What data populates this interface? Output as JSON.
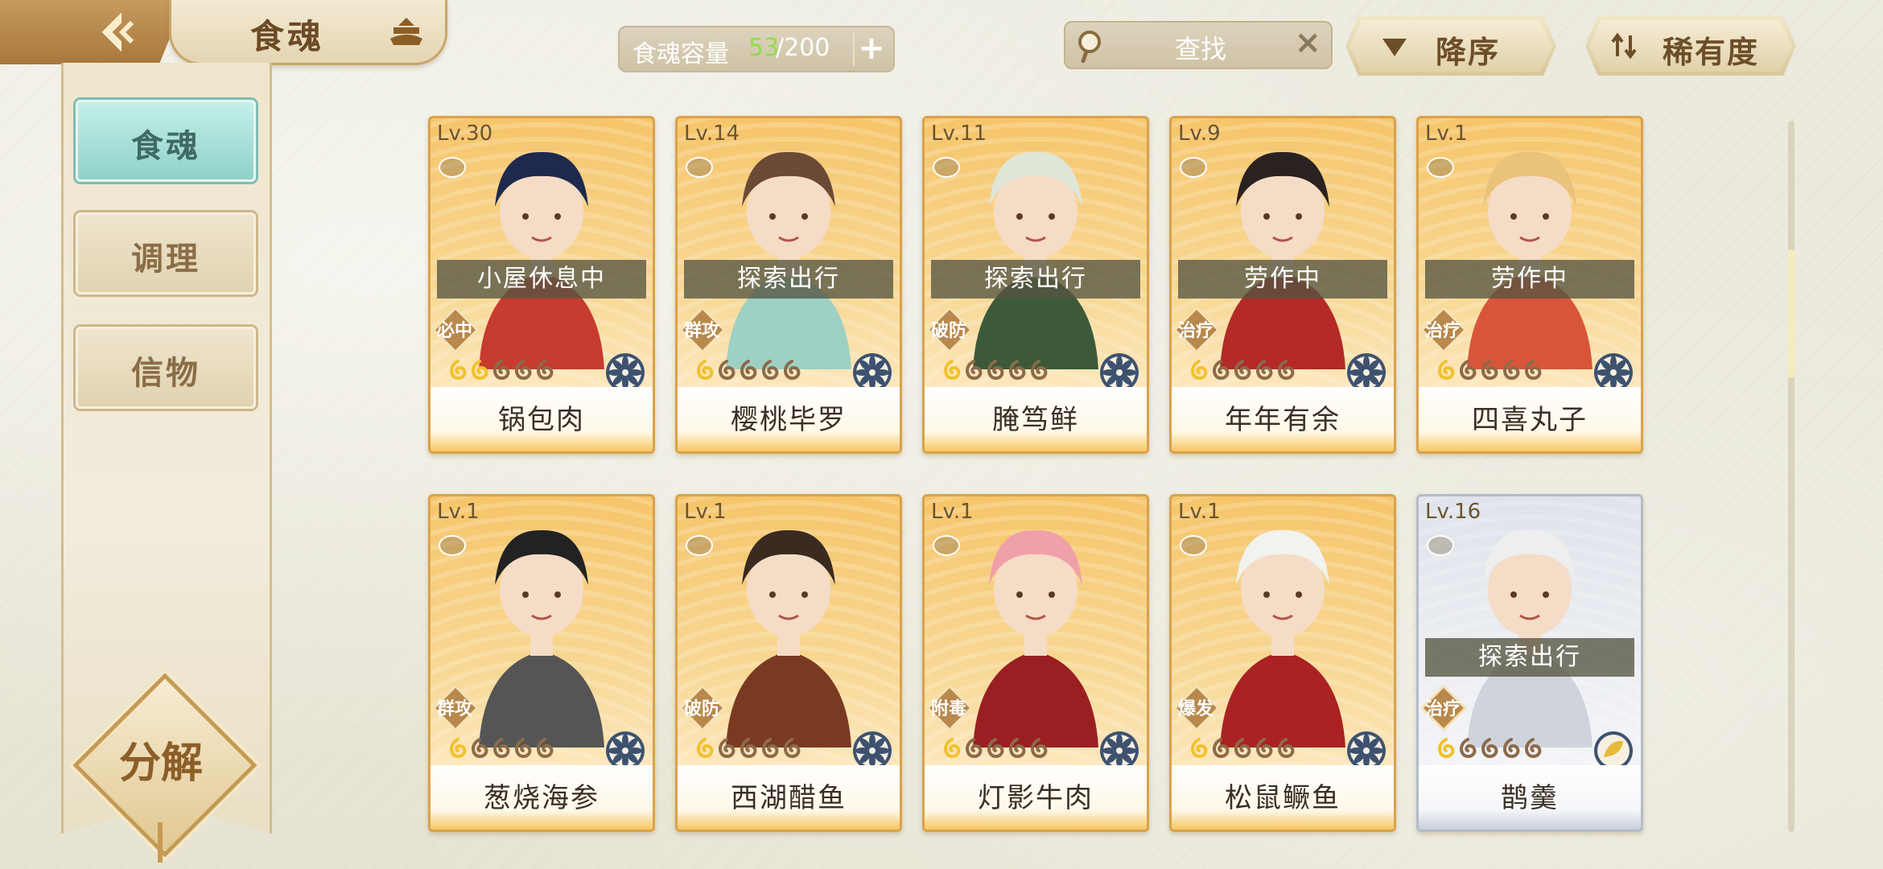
{
  "header": {
    "title": "食魂",
    "capacity_label": "食魂容量",
    "capacity_used": "53",
    "capacity_total": "/200",
    "search_placeholder": "查找",
    "sort_order_label": "降序",
    "sort_by_label": "稀有度"
  },
  "sidebar": {
    "items": [
      {
        "label": "食魂",
        "active": true
      },
      {
        "label": "调理",
        "active": false
      },
      {
        "label": "信物",
        "active": false
      }
    ],
    "decompose_label": "分解"
  },
  "colors": {
    "accent_gold": "#d9a24a",
    "capacity_green": "#8ede4c",
    "active_teal": "#8fd2c9"
  },
  "cards": [
    {
      "level": "Lv.30",
      "status": "小屋休息中",
      "tag": "必中",
      "stars_filled": 2,
      "name": "锅包肉",
      "frame": "gold",
      "element": "flower"
    },
    {
      "level": "Lv.14",
      "status": "探索出行",
      "tag": "群攻",
      "stars_filled": 1,
      "name": "樱桃毕罗",
      "frame": "gold",
      "element": "flower"
    },
    {
      "level": "Lv.11",
      "status": "探索出行",
      "tag": "破防",
      "stars_filled": 1,
      "name": "腌笃鲜",
      "frame": "gold",
      "element": "flower"
    },
    {
      "level": "Lv.9",
      "status": "劳作中",
      "tag": "治疗",
      "stars_filled": 1,
      "name": "年年有余",
      "frame": "gold",
      "element": "flower"
    },
    {
      "level": "Lv.1",
      "status": "劳作中",
      "tag": "治疗",
      "stars_filled": 1,
      "name": "四喜丸子",
      "frame": "gold",
      "element": "flower"
    },
    {
      "level": "Lv.1",
      "status": "",
      "tag": "群攻",
      "stars_filled": 1,
      "name": "葱烧海参",
      "frame": "gold",
      "element": "flower"
    },
    {
      "level": "Lv.1",
      "status": "",
      "tag": "破防",
      "stars_filled": 1,
      "name": "西湖醋鱼",
      "frame": "gold",
      "element": "flower"
    },
    {
      "level": "Lv.1",
      "status": "",
      "tag": "附毒",
      "stars_filled": 1,
      "name": "灯影牛肉",
      "frame": "gold",
      "element": "flower"
    },
    {
      "level": "Lv.1",
      "status": "",
      "tag": "爆发",
      "stars_filled": 1,
      "name": "松鼠鳜鱼",
      "frame": "gold",
      "element": "flower"
    },
    {
      "level": "Lv.16",
      "status": "探索出行",
      "tag": "治疗",
      "stars_filled": 1,
      "name": "鹊羹",
      "frame": "silver",
      "element": "leaf"
    }
  ]
}
